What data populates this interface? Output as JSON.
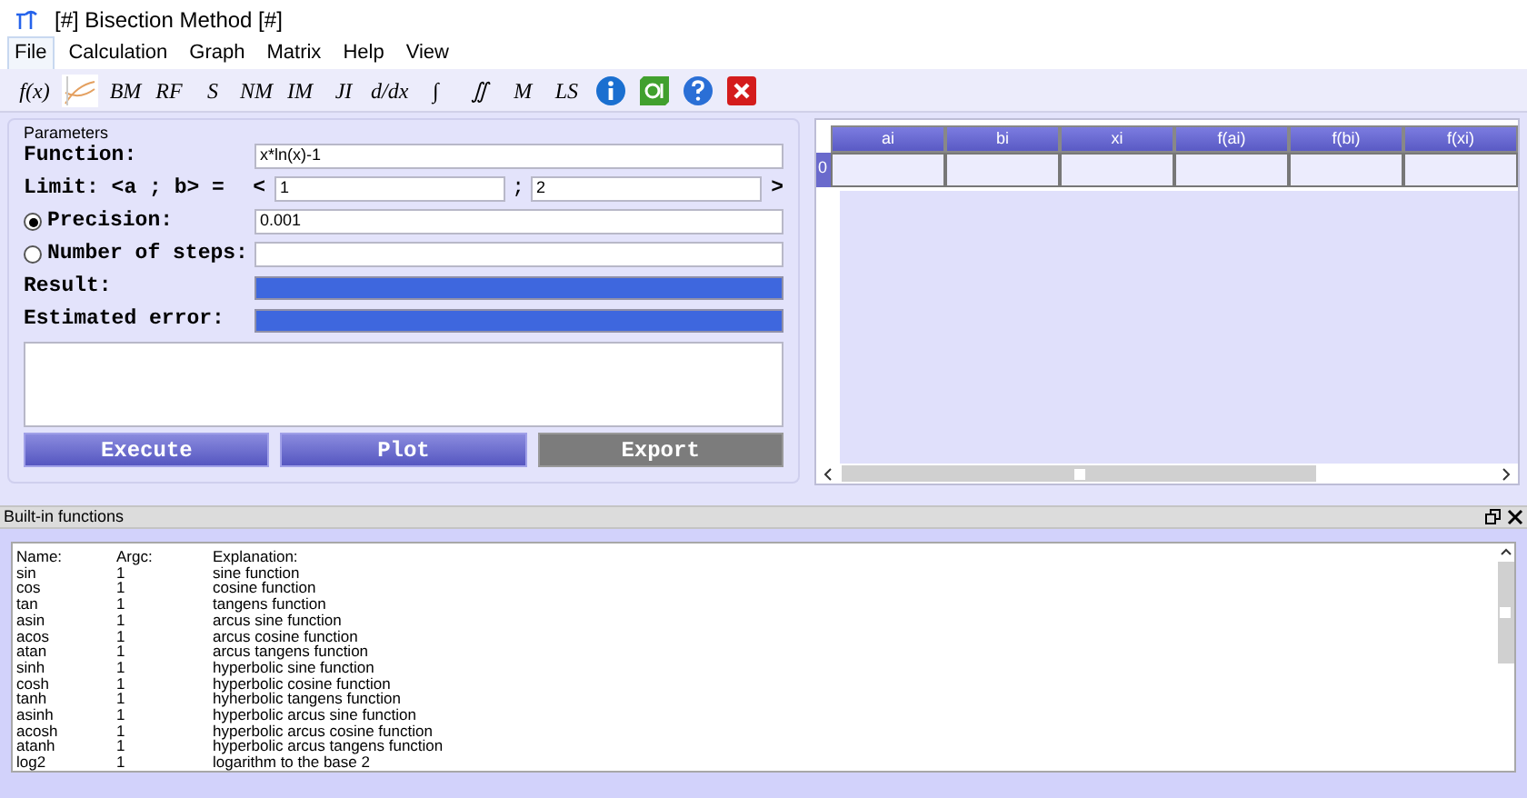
{
  "window": {
    "title": "[#] Bisection Method [#]"
  },
  "menu": [
    {
      "label": "File",
      "selected": true
    },
    {
      "label": "Calculation",
      "selected": false
    },
    {
      "label": "Graph",
      "selected": false
    },
    {
      "label": "Matrix",
      "selected": false
    },
    {
      "label": "Help",
      "selected": false
    },
    {
      "label": "View",
      "selected": false
    }
  ],
  "toolbar": [
    {
      "kind": "text",
      "label": "f(x)"
    },
    {
      "kind": "graph"
    },
    {
      "kind": "text",
      "label": "BM"
    },
    {
      "kind": "text",
      "label": "RF"
    },
    {
      "kind": "text",
      "label": "S"
    },
    {
      "kind": "text",
      "label": "NM"
    },
    {
      "kind": "text",
      "label": "IM"
    },
    {
      "kind": "text",
      "label": "JI"
    },
    {
      "kind": "text",
      "label": "d/dx"
    },
    {
      "kind": "text",
      "label": "∫"
    },
    {
      "kind": "text",
      "label": "∬"
    },
    {
      "kind": "text",
      "label": "M"
    },
    {
      "kind": "text",
      "label": "LS"
    },
    {
      "kind": "info"
    },
    {
      "kind": "qt"
    },
    {
      "kind": "help"
    },
    {
      "kind": "close"
    }
  ],
  "parameters": {
    "title": "Parameters",
    "function": {
      "label": "Function:",
      "value": "x*ln(x)-1"
    },
    "limit": {
      "label": "Limit: <a ; b> =",
      "open": "<",
      "a": "1",
      "sep": ";",
      "b": "2",
      "close": ">"
    },
    "modes": [
      {
        "label": "Precision:",
        "selected": true,
        "value": "0.001"
      },
      {
        "label": "Number of steps:",
        "selected": false
      }
    ],
    "result": {
      "label": "Result:"
    },
    "error": {
      "label": "Estimated error:"
    },
    "buttons": [
      {
        "label": "Execute",
        "disabled": false
      },
      {
        "label": "Plot",
        "disabled": false
      },
      {
        "label": "Export",
        "disabled": true
      }
    ]
  },
  "table": {
    "columns": [
      "ai",
      "bi",
      "xi",
      "f(ai)",
      "f(bi)",
      "f(xi)"
    ],
    "rows": [
      {
        "header": "0"
      }
    ]
  },
  "builtin": {
    "title": "Built-in functions",
    "columns": [
      "Name:",
      "Argc:",
      "Explanation:"
    ],
    "rows": [
      [
        "sin",
        "1",
        "sine function"
      ],
      [
        "cos",
        "1",
        "cosine function"
      ],
      [
        "tan",
        "1",
        "tangens function"
      ],
      [
        "asin",
        "1",
        "arcus sine function"
      ],
      [
        "acos",
        "1",
        "arcus cosine function"
      ],
      [
        "atan",
        "1",
        "arcus tangens function"
      ],
      [
        "sinh",
        "1",
        "hyperbolic sine function"
      ],
      [
        "cosh",
        "1",
        "hyperbolic cosine function"
      ],
      [
        "tanh",
        "1",
        "hyherbolic tangens function"
      ],
      [
        "asinh",
        "1",
        "hyperbolic arcus sine function"
      ],
      [
        "acosh",
        "1",
        "hyperbolic arcus cosine function"
      ],
      [
        "atanh",
        "1",
        "hyperbolic arcus tangens function"
      ],
      [
        "log2",
        "1",
        "logarithm to the base 2"
      ]
    ]
  }
}
